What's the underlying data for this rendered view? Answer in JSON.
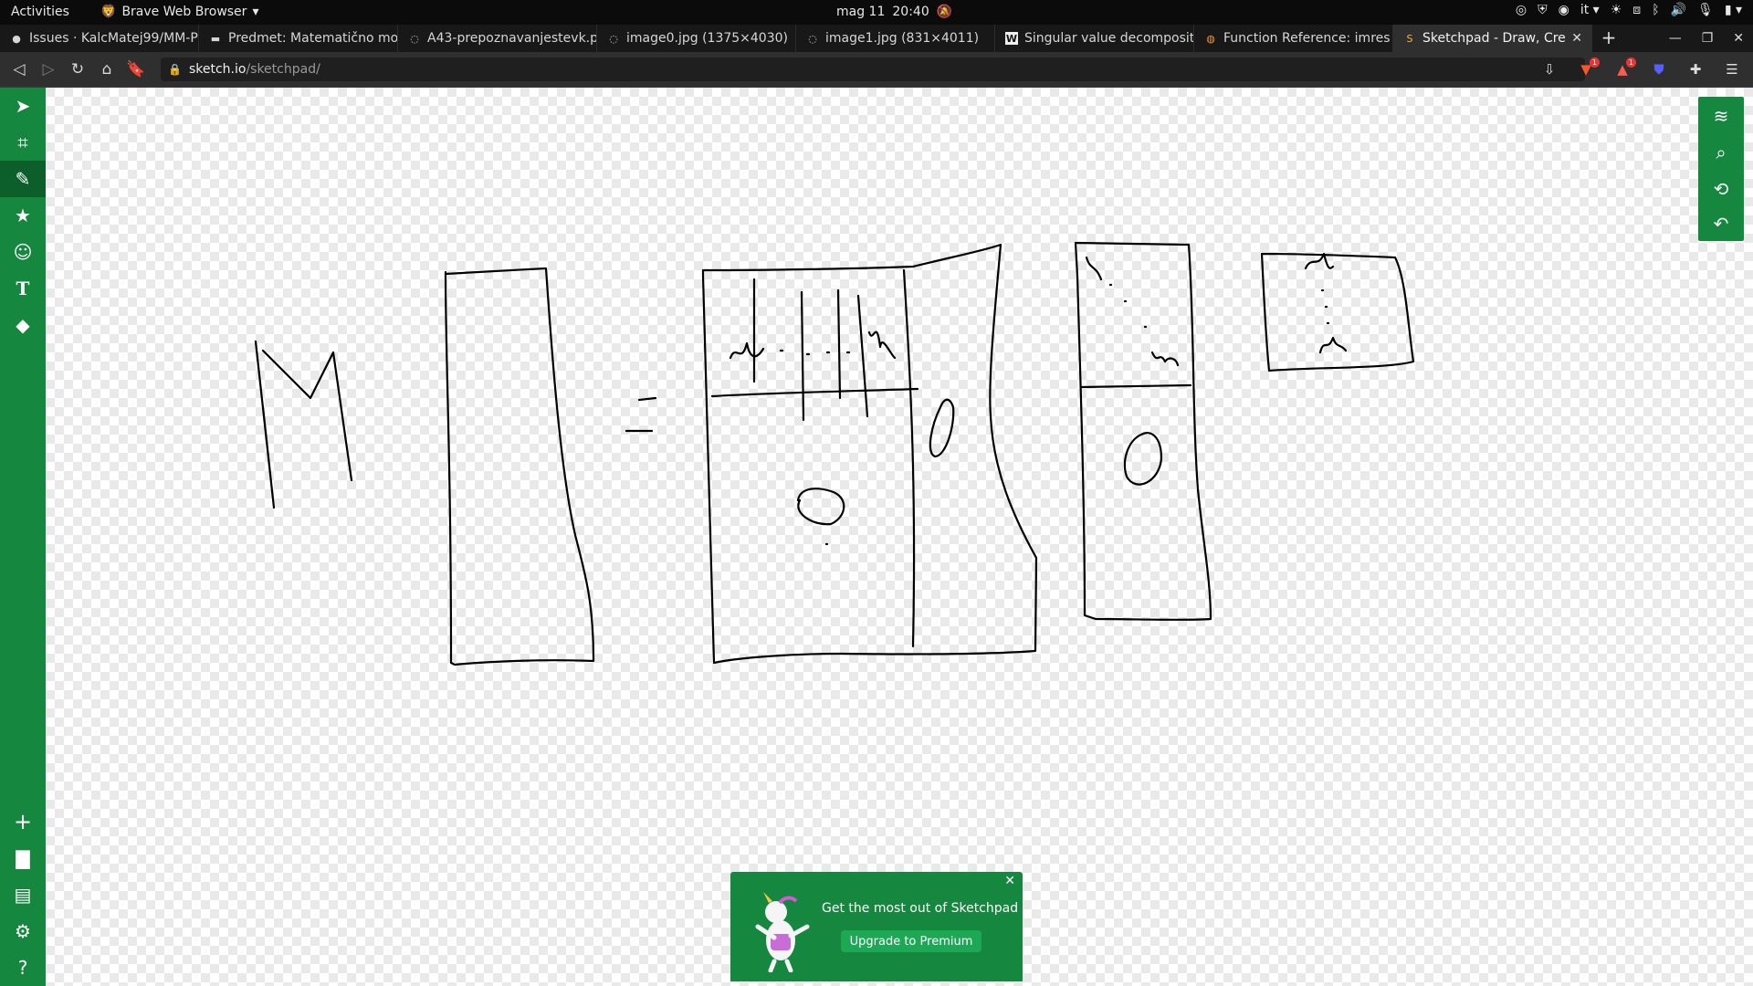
{
  "topbar": {
    "activities": "Activities",
    "app_name": "Brave Web Browser",
    "date": "mag 11",
    "time": "20:40",
    "lang": "it"
  },
  "tabs": [
    {
      "title": "Issues · KalcMatej99/MM-P",
      "favicon": "github-icon"
    },
    {
      "title": "Predmet: Matematično mo",
      "favicon": "course-icon"
    },
    {
      "title": "A43-prepoznavanjestevk.p",
      "favicon": "globe-icon"
    },
    {
      "title": "image0.jpg (1375×4030)",
      "favicon": "globe-icon"
    },
    {
      "title": "image1.jpg (831×4011)",
      "favicon": "globe-icon"
    },
    {
      "title": "Singular value decomposit",
      "favicon": "wikipedia-icon"
    },
    {
      "title": "Function Reference: imres",
      "favicon": "octave-icon"
    },
    {
      "title": "Sketchpad - Draw, Crea",
      "favicon": "sketchpad-icon",
      "active": true
    }
  ],
  "address": {
    "host": "sketch.io",
    "path": "/sketchpad/"
  },
  "promo": {
    "text": "Get the most out of Sketchpad",
    "button": "Upgrade to Premium"
  },
  "colors": {
    "sketch_green": "#15873f",
    "sketch_green_dark": "#0c5f2b"
  },
  "icons": {
    "left_tools": [
      "pointer-icon",
      "crop-icon",
      "pencil-icon",
      "star-icon",
      "sticker-icon",
      "text-icon",
      "fill-icon"
    ],
    "left_bottom": [
      "add-icon",
      "folder-icon",
      "save-icon",
      "settings-icon",
      "help-icon"
    ],
    "right_tools": [
      "layers-icon",
      "zoom-icon",
      "history-icon",
      "undo-icon"
    ]
  }
}
